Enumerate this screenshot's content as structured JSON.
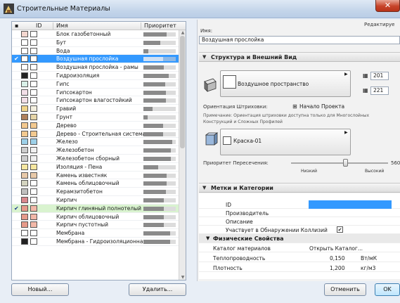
{
  "window": {
    "title": "Строительные Материалы",
    "close_glyph": "✕"
  },
  "list": {
    "headers": {
      "id": "ID",
      "name": "Имя",
      "priority": "Приоритет"
    },
    "check_glyph": "✔",
    "rows": [
      {
        "name": "Блок газобетонный",
        "c1": "#f4d7cf",
        "c2": "#ffffff",
        "pr": 0.72,
        "check": false,
        "state": ""
      },
      {
        "name": "Бут",
        "c1": "#ffffff",
        "c2": "#ffffff",
        "pr": 0.52,
        "check": false,
        "state": ""
      },
      {
        "name": "Вода",
        "c1": "#ffffff",
        "c2": "#ffffff",
        "pr": 0.15,
        "check": false,
        "state": ""
      },
      {
        "name": "Воздушная прослойка",
        "c1": "#ffffff",
        "c2": "#ffffff",
        "pr": 0.6,
        "check": true,
        "state": "sel"
      },
      {
        "name": "Воздушная прослойка - рамы",
        "c1": "#ffffff",
        "c2": "#ffffff",
        "pr": 0.62,
        "check": false,
        "state": ""
      },
      {
        "name": "Гидроизоляция",
        "c1": "#222222",
        "c2": "#ffffff",
        "pr": 0.78,
        "check": false,
        "state": ""
      },
      {
        "name": "Гипс",
        "c1": "#d9f0e8",
        "c2": "#ffffff",
        "pr": 0.68,
        "check": false,
        "state": ""
      },
      {
        "name": "Гипсокартон",
        "c1": "#f2dfe8",
        "c2": "#ffffff",
        "pr": 0.7,
        "check": false,
        "state": ""
      },
      {
        "name": "Гипсокартон влагостойкий",
        "c1": "#f2dfe8",
        "c2": "#ffffff",
        "pr": 0.7,
        "check": false,
        "state": ""
      },
      {
        "name": "Гравий",
        "c1": "#f0d48a",
        "c2": "#f4f0e0",
        "pr": 0.28,
        "check": false,
        "state": ""
      },
      {
        "name": "Грунт",
        "c1": "#b0805a",
        "c2": "#e6d5a8",
        "pr": 0.12,
        "check": false,
        "state": ""
      },
      {
        "name": "Дерево",
        "c1": "#f3c98f",
        "c2": "#f3c98f",
        "pr": 0.6,
        "check": false,
        "state": ""
      },
      {
        "name": "Дерево - Строительная система",
        "c1": "#f3c98f",
        "c2": "#f3c98f",
        "pr": 0.6,
        "check": false,
        "state": ""
      },
      {
        "name": "Железо",
        "c1": "#9cd0e8",
        "c2": "#9cd0e8",
        "pr": 0.9,
        "check": false,
        "state": ""
      },
      {
        "name": "Железобетон",
        "c1": "#cdcdcd",
        "c2": "#f0f0f0",
        "pr": 0.85,
        "check": false,
        "state": ""
      },
      {
        "name": "Железобетон сборный",
        "c1": "#cdcdcd",
        "c2": "#f0f0f0",
        "pr": 0.85,
        "check": false,
        "state": ""
      },
      {
        "name": "Изоляция - Пена",
        "c1": "#f6e7a0",
        "c2": "#f6e7a0",
        "pr": 0.45,
        "check": false,
        "state": ""
      },
      {
        "name": "Камень известняк",
        "c1": "#e8c9a8",
        "c2": "#e8c9a8",
        "pr": 0.72,
        "check": false,
        "state": ""
      },
      {
        "name": "Камень облицовочный",
        "c1": "#d4d4c0",
        "c2": "#ffffff",
        "pr": 0.72,
        "check": false,
        "state": ""
      },
      {
        "name": "Керамзитобетон",
        "c1": "#bfbfbf",
        "c2": "#ffffff",
        "pr": 0.7,
        "check": false,
        "state": ""
      },
      {
        "name": "Кирпич",
        "c1": "#d9878c",
        "c2": "#ffffff",
        "pr": 0.64,
        "check": false,
        "state": ""
      },
      {
        "name": "Кирпич глиняный полнотелый",
        "c1": "#e69a8a",
        "c2": "#f2b8a8",
        "pr": 0.64,
        "check": true,
        "state": "hl"
      },
      {
        "name": "Кирпич облицовочный",
        "c1": "#e69a8a",
        "c2": "#f2b8a8",
        "pr": 0.64,
        "check": false,
        "state": ""
      },
      {
        "name": "Кирпич пустотный",
        "c1": "#e69a8a",
        "c2": "#f2b8a8",
        "pr": 0.64,
        "check": false,
        "state": ""
      },
      {
        "name": "Мембрана",
        "c1": "#ffffff",
        "c2": "#ffffff",
        "pr": 0.82,
        "check": false,
        "state": ""
      },
      {
        "name": "Мембрана - Гидроизоляционная",
        "c1": "#222222",
        "c2": "#ffffff",
        "pr": 0.82,
        "check": false,
        "state": ""
      }
    ]
  },
  "buttons": {
    "new": "Новый...",
    "delete": "Удалить...",
    "cancel": "Отменить",
    "ok": "OK"
  },
  "right": {
    "edit_label": "Редактируе",
    "name_label": "Имя:",
    "name_value": "Воздушная прослойка",
    "section_structure": "Структура и Внешний Вид",
    "surface_name": "Воздушное пространство",
    "pen1": "201",
    "pen2": "221",
    "hatch_orientation_label": "Ориентация Штриховки:",
    "hatch_orientation_value": "Начало Проекта",
    "note": "Примечание: Ориентация штриховки доступна только для Многослойных Конструкций и Сложных Профилей",
    "paint_name": "Краска-01",
    "priority_label": "Приоритет Пересечения:",
    "priority_low": "Низкий",
    "priority_high": "Высокий",
    "priority_value": "560",
    "slider_level": 0.56,
    "section_tags": "Метки и Категории",
    "props": [
      {
        "label": "ID",
        "value": "",
        "unit": ""
      },
      {
        "label": "Производитель",
        "value": "",
        "unit": ""
      },
      {
        "label": "Описание",
        "value": "",
        "unit": ""
      },
      {
        "label": "Участвует в Обнаружении Коллизий",
        "value": "✔",
        "unit": ""
      }
    ],
    "section_physical": "Физические Свойства",
    "physical": [
      {
        "label": "Каталог материалов",
        "value": "Открыть Каталог...",
        "unit": ""
      },
      {
        "label": "Теплопроводность",
        "value": "0,150",
        "unit": "Вт/мК"
      },
      {
        "label": "Плотность",
        "value": "1,200",
        "unit": "кг/м3"
      }
    ]
  },
  "colors": {
    "selection": "#3399ff",
    "highlight": "#d9f3cf",
    "titlebar": "#c4d5ea"
  }
}
